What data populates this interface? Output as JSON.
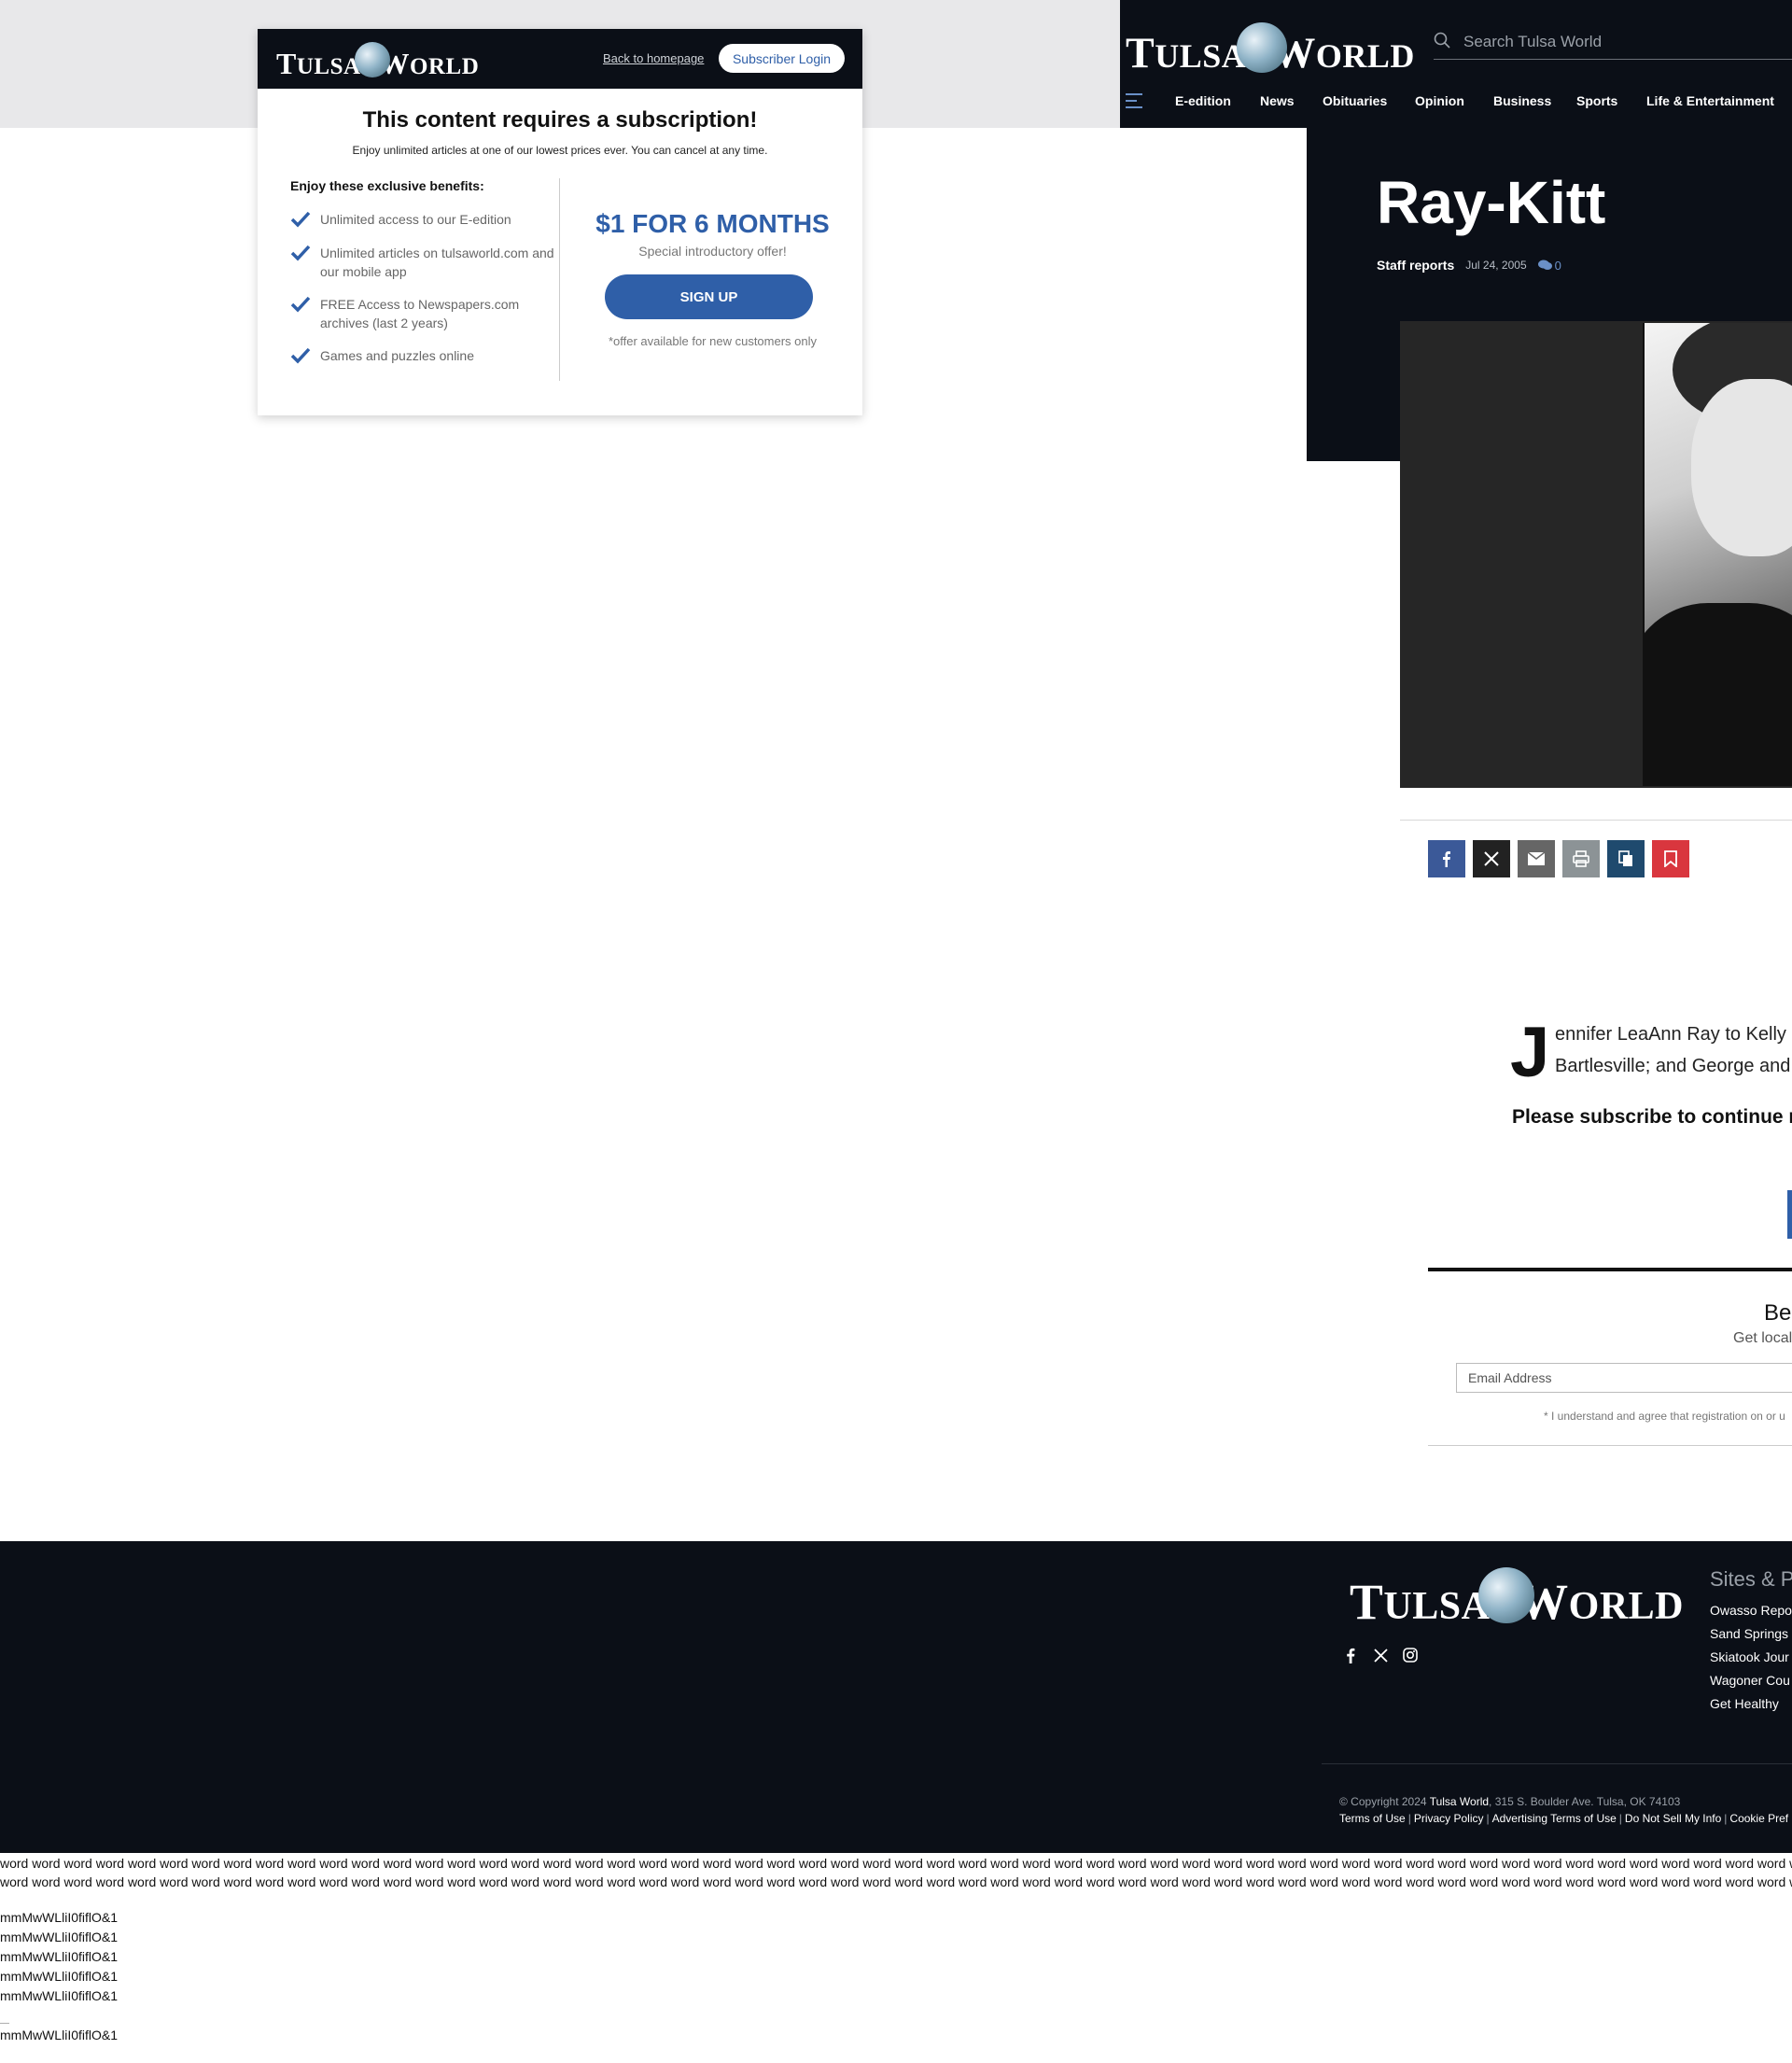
{
  "modal": {
    "logo_text": "TULSA WORLD",
    "back_link": "Back to homepage",
    "login_button": "Subscriber Login",
    "title": "This content requires a subscription!",
    "subtitle": "Enjoy unlimited articles at one of our lowest prices ever. You can cancel at any time.",
    "benefits_title": "Enjoy these exclusive benefits:",
    "benefits": [
      "Unlimited access to our E-edition",
      "Unlimited articles on tulsaworld.com and our mobile app",
      "FREE Access to Newspapers.com archives (last 2 years)",
      "Games and puzzles online"
    ],
    "price": "$1 FOR 6 MONTHS",
    "intro": "Special introductory offer!",
    "signup_button": "SIGN UP",
    "offer_note": "*offer available for new customers only",
    "accent_color": "#2f5fa8"
  },
  "header": {
    "logo_text": "TULSA WORLD",
    "search_placeholder": "Search Tulsa World",
    "nav": [
      "E-edition",
      "News",
      "Obituaries",
      "Opinion",
      "Business",
      "Sports",
      "Life & Entertainment"
    ]
  },
  "article": {
    "headline": "Ray-Kitt",
    "author": "Staff reports",
    "date": "Jul 24, 2005",
    "comment_count": "0",
    "share_icons": [
      "facebook-icon",
      "x-icon",
      "email-icon",
      "print-icon",
      "copy-icon",
      "bookmark-icon"
    ],
    "dropcap": "J",
    "body_lines": [
      "ennifer LeaAnn Ray to Kelly",
      "Bartlesville; and George and"
    ],
    "subscribe_message": "Please subscribe to continue re"
  },
  "newsletter": {
    "title": "Be",
    "subtitle": "Get local",
    "email_placeholder": "Email Address",
    "disclaimer": "* I understand and agree that registration on or u"
  },
  "footer": {
    "logo_text": "TULSA WORLD",
    "social_icons": [
      "facebook-icon",
      "x-icon",
      "instagram-icon"
    ],
    "sites_title": "Sites & Pa",
    "sites": [
      "Owasso Repo",
      "Sand Springs",
      "Skiatook Jour",
      "Wagoner Cou",
      "Get Healthy"
    ],
    "copyright_prefix": "© Copyright 2024",
    "copyright_org": "Tulsa World",
    "copyright_address": ", 315 S. Boulder Ave. Tulsa, OK 74103",
    "legal_links": [
      "Terms of Use",
      "Privacy Policy",
      "Advertising Terms of Use",
      "Do Not Sell My Info",
      "Cookie Pref"
    ]
  },
  "test_text": {
    "word_line": "word word word word word word word word word word word word word word word word word word word word word word word word word word word word word word word word word word word word word word word word word word word word word word word word word word word word word word word word word word word word word word word word word word word word word word word word word word word word word word word word word word",
    "glyph_line": "mmMwWLliI0fiflO&1",
    "dash": "—"
  }
}
